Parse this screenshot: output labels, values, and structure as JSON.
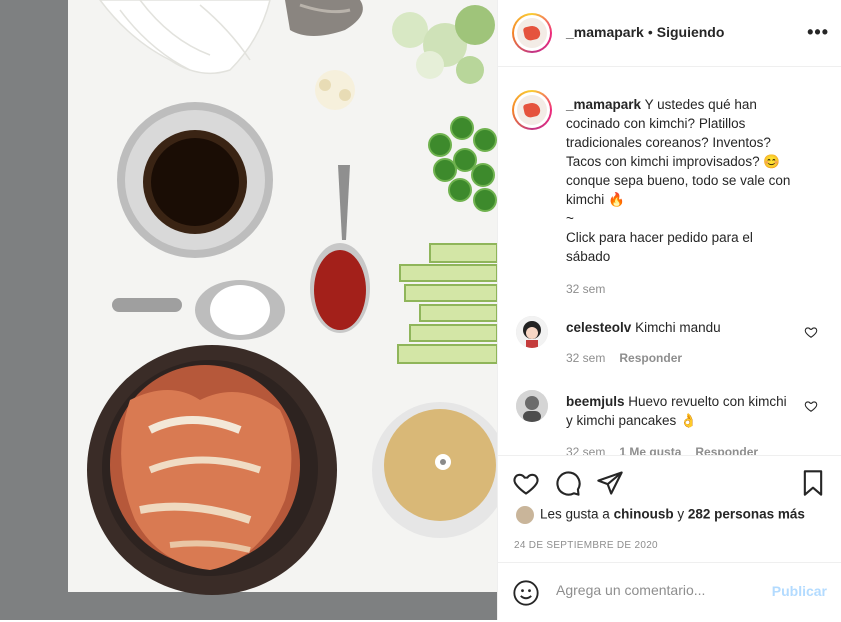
{
  "post": {
    "username": "_mamapark",
    "separator": "•",
    "follow_status": "Siguiendo",
    "more_icon": "more-icon"
  },
  "caption": {
    "username": "_mamapark",
    "lines": [
      "Y ustedes qué han",
      "cocinado con kimchi? Platillos",
      "tradicionales coreanos? Inventos?",
      "Tacos con kimchi improvisados? 😊",
      "conque sepa bueno, todo se vale con",
      "kimchi 🔥",
      "~",
      "Click para hacer pedido para el",
      "sábado"
    ],
    "time": "32 sem"
  },
  "comments": [
    {
      "username": "celesteolv",
      "text": "Kimchi mandu",
      "time": "32 sem",
      "reply": "Responder"
    },
    {
      "username": "beemjuls",
      "text": "Huevo revuelto con kimchi y kimchi pancakes 👌",
      "time": "32 sem",
      "likes": "1 Me gusta",
      "reply": "Responder"
    }
  ],
  "likes": {
    "prefix": "Les gusta a",
    "user": "chinousb",
    "connector": "y",
    "others": "282 personas más"
  },
  "date": "24 DE SEPTIEMBRE DE 2020",
  "add_comment": {
    "placeholder": "Agrega un comentario...",
    "publish": "Publicar"
  },
  "colors": {
    "text": "#262626",
    "muted": "#8e8e8e",
    "publish_disabled": "#b3dbff",
    "divider": "#efefef"
  }
}
